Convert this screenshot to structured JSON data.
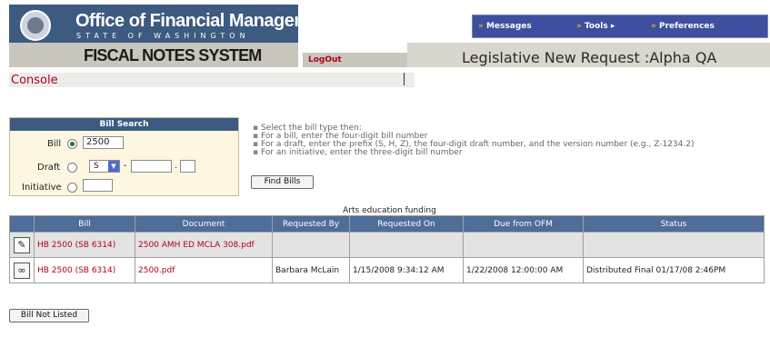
{
  "header": {
    "org_title": "Office of Financial Management",
    "org_subtitle": "STATE OF WASHINGTON",
    "system_name": "FISCAL NOTES SYSTEM",
    "logout_label": "LogOut",
    "page_heading": "Legislative New Request :Alpha QA",
    "menu": [
      {
        "label": "Messages",
        "icon": "bullet-arrow-icon"
      },
      {
        "label": "Tools",
        "icon": "submenu-arrow-icon"
      },
      {
        "label": "Preferences",
        "icon": "bullet-arrow-icon"
      }
    ]
  },
  "console": {
    "label": "Console"
  },
  "bill_search": {
    "title": "Bill Search",
    "bill_label": "Bill",
    "bill_value": "2500",
    "draft_label": "Draft",
    "draft_prefix": "S",
    "draft_sep1": "-",
    "draft_sep2": ".",
    "initiative_label": "Initiative",
    "selected": "Bill"
  },
  "instructions": [
    "Select the bill type then:",
    "For a bill, enter the four-digit bill number",
    "For a draft, enter the prefix (S, H, Z), the four-digit draft number, and the version number (e.g., Z-1234.2)",
    "For an initiative, enter the three-digit bill number"
  ],
  "find_button": "Find Bills",
  "results": {
    "caption": "Arts education funding",
    "columns": [
      "",
      "Bill",
      "Document",
      "Requested By",
      "Requested On",
      "Due from OFM",
      "Status"
    ],
    "rows": [
      {
        "icon": "edit-document-icon",
        "bill": "HB 2500 (SB 6314)",
        "document": "2500 AMH ED MCLA 308.pdf",
        "requested_by": "",
        "requested_on": "",
        "due": "",
        "status": ""
      },
      {
        "icon": "binoculars-icon",
        "bill": "HB 2500 (SB 6314)",
        "document": "2500.pdf",
        "requested_by": "Barbara McLain",
        "requested_on": "1/15/2008 9:34:12 AM",
        "due": "1/22/2008 12:00:00 AM",
        "status": "Distributed Final 01/17/08 2:46PM"
      }
    ]
  },
  "bill_not_listed_button": "Bill Not Listed",
  "colors": {
    "brand_navy": "#3d5a80",
    "menu_blue": "#3d4f9e",
    "link_red": "#b00020",
    "table_header": "#4e6d98"
  }
}
